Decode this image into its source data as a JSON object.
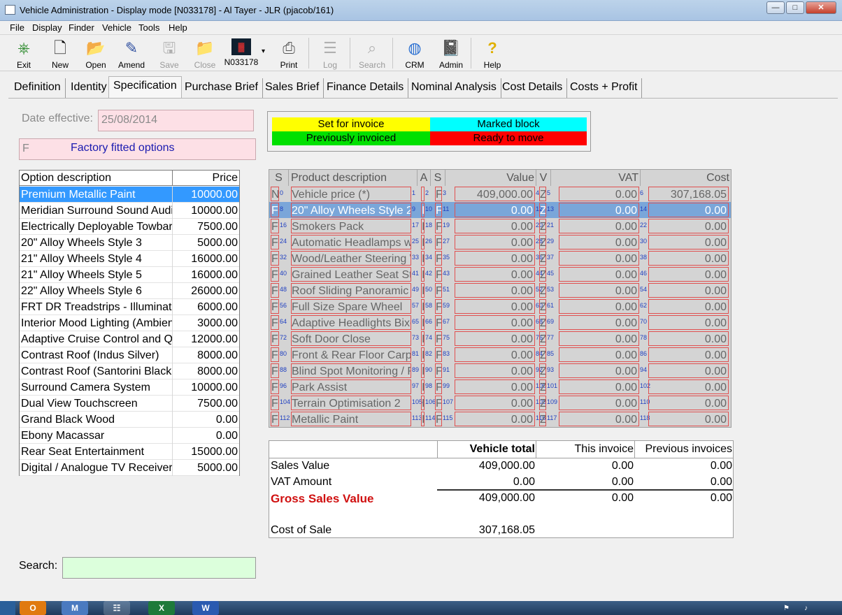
{
  "window": {
    "title": "Vehicle Administration - Display mode [N033178] - Al Tayer - JLR (pjacob/161)",
    "minimize_glyph": "—",
    "maximize_glyph": "□",
    "close_glyph": "✕"
  },
  "menu": [
    "File",
    "Display",
    "Finder",
    "Vehicle",
    "Tools",
    "Help"
  ],
  "toolbar": {
    "exit": "Exit",
    "new": "New",
    "open": "Open",
    "amend": "Amend",
    "save": "Save",
    "close": "Close",
    "record": "N033178",
    "print": "Print",
    "log": "Log",
    "search": "Search",
    "crm": "CRM",
    "admin": "Admin",
    "help": "Help",
    "help_glyph": "?"
  },
  "tabs": [
    "Definition",
    "Identity",
    "Specification",
    "Purchase Brief",
    "Sales Brief",
    "Finance Details",
    "Nominal Analysis",
    "Cost Details",
    "Costs + Profit"
  ],
  "date_effective": {
    "label": "Date effective:",
    "value": "25/08/2014"
  },
  "options_type": {
    "code": "F",
    "label": "Factory fitted options"
  },
  "legend": {
    "set_for_invoice": "Set for invoice",
    "marked_block": "Marked block",
    "previously_invoiced": "Previously invoiced",
    "ready_to_move": "Ready to move",
    "colors": {
      "set_for_invoice": "#ffff00",
      "marked_block": "#00ffff",
      "previously_invoiced": "#00e000",
      "ready_to_move": "#ff0000"
    }
  },
  "options": {
    "headers": {
      "description": "Option description",
      "price": "Price"
    },
    "rows": [
      {
        "d": "Premium Metallic Paint",
        "p": "10000.00"
      },
      {
        "d": "Meridian Surround Sound Audi",
        "p": "10000.00"
      },
      {
        "d": "Electrically Deployable Towbar",
        "p": "7500.00"
      },
      {
        "d": "20\" Alloy Wheels Style 3",
        "p": "5000.00"
      },
      {
        "d": "21\" Alloy Wheels Style 4",
        "p": "16000.00"
      },
      {
        "d": "21\" Alloy Wheels Style 5",
        "p": "16000.00"
      },
      {
        "d": "22\" Alloy Wheels Style 6",
        "p": "26000.00"
      },
      {
        "d": "FRT DR Treadstrips - Illuminate",
        "p": "6000.00"
      },
      {
        "d": "Interior Mood Lighting (Ambien",
        "p": "3000.00"
      },
      {
        "d": "Adaptive Cruise Control and Qu",
        "p": "12000.00"
      },
      {
        "d": "Contrast Roof (Indus Silver)",
        "p": "8000.00"
      },
      {
        "d": "Contrast Roof (Santorini Black",
        "p": "8000.00"
      },
      {
        "d": "Surround Camera System",
        "p": "10000.00"
      },
      {
        "d": "Dual View Touchscreen",
        "p": "7500.00"
      },
      {
        "d": "Grand Black Wood",
        "p": "0.00"
      },
      {
        "d": "Ebony Macassar",
        "p": "0.00"
      },
      {
        "d": "Rear Seat Entertainment",
        "p": "15000.00"
      },
      {
        "d": "Digital / Analogue TV Receiver",
        "p": "5000.00"
      }
    ]
  },
  "products": {
    "headers": {
      "s1": "S",
      "desc": "Product description",
      "a": "A",
      "s2": "S",
      "value": "Value",
      "v": "V",
      "vat": "VAT",
      "cost": "Cost"
    },
    "rows": [
      {
        "s": "N",
        "desc": "Vehicle price (*)",
        "a": "",
        "s2": "F",
        "value": "409,000.00",
        "v": "Z",
        "vat": "0.00",
        "cost": "307,168.05",
        "n": [
          "0",
          "1",
          "2",
          "3",
          "4",
          "5",
          "6"
        ]
      },
      {
        "s": "F",
        "desc": "20\" Alloy Wheels Style 2",
        "a": "I",
        "s2": "F",
        "value": "0.00",
        "v": "Z",
        "vat": "0.00",
        "cost": "0.00",
        "n": [
          "8",
          "9",
          "10",
          "11",
          "12",
          "13",
          "14"
        ]
      },
      {
        "s": "F",
        "desc": "Smokers Pack",
        "a": "I",
        "s2": "F",
        "value": "0.00",
        "v": "Z",
        "vat": "0.00",
        "cost": "0.00",
        "n": [
          "16",
          "17",
          "18",
          "19",
          "20",
          "21",
          "22"
        ]
      },
      {
        "s": "F",
        "desc": "Automatic Headlamps wi",
        "a": "I",
        "s2": "F",
        "value": "0.00",
        "v": "Z",
        "vat": "0.00",
        "cost": "0.00",
        "n": [
          "24",
          "25",
          "26",
          "27",
          "28",
          "29",
          "30"
        ]
      },
      {
        "s": "F",
        "desc": "Wood/Leather Steering W",
        "a": "I",
        "s2": "F",
        "value": "0.00",
        "v": "Z",
        "vat": "0.00",
        "cost": "0.00",
        "n": [
          "32",
          "33",
          "34",
          "35",
          "36",
          "37",
          "38"
        ]
      },
      {
        "s": "F",
        "desc": "Grained Leather Seat Sty",
        "a": "I",
        "s2": "F",
        "value": "0.00",
        "v": "Z",
        "vat": "0.00",
        "cost": "0.00",
        "n": [
          "40",
          "41",
          "42",
          "43",
          "44",
          "45",
          "46"
        ]
      },
      {
        "s": "F",
        "desc": "Roof Sliding Panoramic",
        "a": "I",
        "s2": "F",
        "value": "0.00",
        "v": "Z",
        "vat": "0.00",
        "cost": "0.00",
        "n": [
          "48",
          "49",
          "50",
          "51",
          "52",
          "53",
          "54"
        ]
      },
      {
        "s": "F",
        "desc": "Full Size Spare Wheel",
        "a": "I",
        "s2": "F",
        "value": "0.00",
        "v": "Z",
        "vat": "0.00",
        "cost": "0.00",
        "n": [
          "56",
          "57",
          "58",
          "59",
          "60",
          "61",
          "62"
        ]
      },
      {
        "s": "F",
        "desc": "Adaptive Headlights Bixe",
        "a": "I",
        "s2": "F",
        "value": "0.00",
        "v": "Z",
        "vat": "0.00",
        "cost": "0.00",
        "n": [
          "64",
          "65",
          "66",
          "67",
          "68",
          "69",
          "70"
        ]
      },
      {
        "s": "F",
        "desc": "Soft Door Close",
        "a": "I",
        "s2": "F",
        "value": "0.00",
        "v": "Z",
        "vat": "0.00",
        "cost": "0.00",
        "n": [
          "72",
          "73",
          "74",
          "75",
          "76",
          "77",
          "78"
        ]
      },
      {
        "s": "F",
        "desc": "Front & Rear Floor Carpe",
        "a": "I",
        "s2": "F",
        "value": "0.00",
        "v": "Z",
        "vat": "0.00",
        "cost": "0.00",
        "n": [
          "80",
          "81",
          "82",
          "83",
          "84",
          "85",
          "86"
        ]
      },
      {
        "s": "F",
        "desc": "Blind Spot Monitoring / Re",
        "a": "I",
        "s2": "F",
        "value": "0.00",
        "v": "Z",
        "vat": "0.00",
        "cost": "0.00",
        "n": [
          "88",
          "89",
          "90",
          "91",
          "92",
          "93",
          "94"
        ]
      },
      {
        "s": "F",
        "desc": "Park Assist",
        "a": "I",
        "s2": "F",
        "value": "0.00",
        "v": "Z",
        "vat": "0.00",
        "cost": "0.00",
        "n": [
          "96",
          "97",
          "98",
          "99",
          "100",
          "101",
          "102"
        ]
      },
      {
        "s": "F",
        "desc": "Terrain Optimisation 2",
        "a": "I",
        "s2": "F",
        "value": "0.00",
        "v": "Z",
        "vat": "0.00",
        "cost": "0.00",
        "n": [
          "104",
          "105",
          "106",
          "107",
          "108",
          "109",
          "110"
        ]
      },
      {
        "s": "F",
        "desc": "Metallic Paint",
        "a": "I",
        "s2": "F",
        "value": "0.00",
        "v": "Z",
        "vat": "0.00",
        "cost": "0.00",
        "n": [
          "112",
          "113",
          "114",
          "115",
          "116",
          "117",
          "118"
        ]
      }
    ]
  },
  "totals": {
    "headers": {
      "vehicle_total": "Vehicle total",
      "this_invoice": "This invoice",
      "previous_invoices": "Previous invoices"
    },
    "sales_value": {
      "label": "Sales Value",
      "vehicle_total": "409,000.00",
      "this_invoice": "0.00",
      "previous": "0.00"
    },
    "vat_amount": {
      "label": "VAT Amount",
      "vehicle_total": "0.00",
      "this_invoice": "0.00",
      "previous": "0.00"
    },
    "gross_sales_value": {
      "label": "Gross Sales Value",
      "vehicle_total": "409,000.00",
      "this_invoice": "0.00",
      "previous": "0.00"
    },
    "cost_of_sale": {
      "label": "Cost of Sale",
      "vehicle_total": "307,168.05"
    }
  },
  "search": {
    "label": "Search:",
    "value": ""
  },
  "taskbar": {
    "apps": [
      "O",
      "M",
      "☷",
      "X",
      "W"
    ]
  }
}
